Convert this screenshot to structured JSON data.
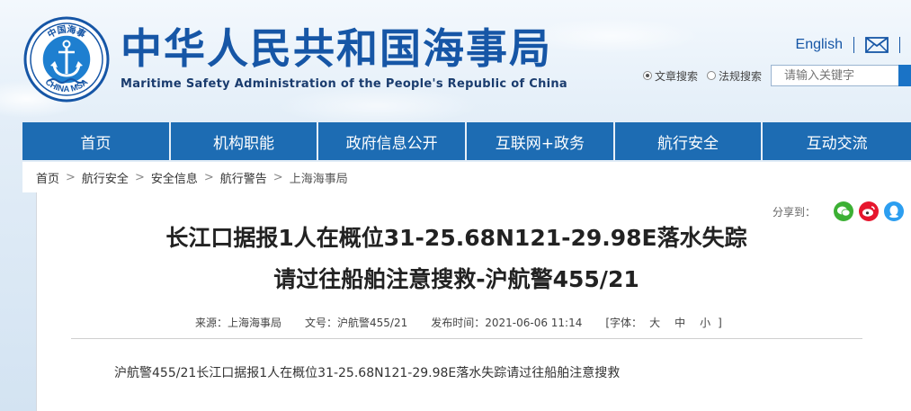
{
  "header": {
    "site_title": "中华人民共和国海事局",
    "site_subtitle": "Maritime Safety Administration of the People's Republic of China",
    "logo_top_text": "中国海事",
    "logo_bottom_text": "CHINA MSA",
    "english_link": "English",
    "search": {
      "option_article": "文章搜索",
      "option_law": "法规搜索",
      "selected": "文章搜索",
      "placeholder": "请输入关键字"
    }
  },
  "nav": {
    "items": [
      "首页",
      "机构职能",
      "政府信息公开",
      "互联网+政务",
      "航行安全",
      "互动交流"
    ]
  },
  "breadcrumb": {
    "items": [
      "首页",
      "航行安全",
      "安全信息",
      "航行警告",
      "上海海事局"
    ],
    "separator": ">"
  },
  "share": {
    "label": "分享到：",
    "icons": [
      "wechat-icon",
      "weibo-icon",
      "qq-icon"
    ]
  },
  "article": {
    "title_line1": "长江口据报1人在概位31-25.68N121-29.98E落水失踪",
    "title_line2": "请过往船舶注意搜救-沪航警455/21",
    "source": "来源：上海海事局",
    "doc_no": "文号：沪航警455/21",
    "publish_time": "发布时间：2021-06-06 11:14",
    "font_label": "[字体：",
    "font_large": "大",
    "font_medium": "中",
    "font_small": "小",
    "font_close": "]",
    "body": "沪航警455/21长江口据报1人在概位31-25.68N121-29.98E落水失踪请过往船舶注意搜救"
  },
  "colors": {
    "brand_blue": "#1656a6",
    "nav_blue": "#1d6cb3",
    "wechat": "#3cb034",
    "weibo": "#e6162d",
    "qq": "#2c9ef0"
  }
}
